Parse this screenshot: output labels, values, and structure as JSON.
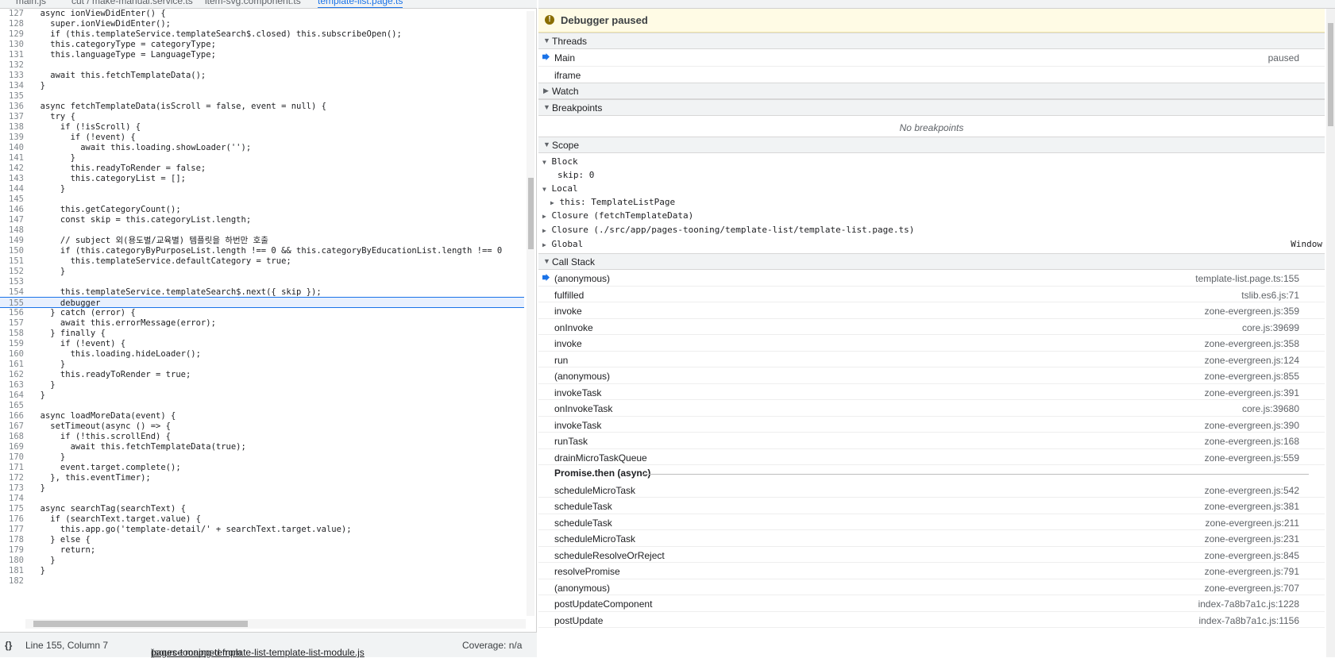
{
  "tabs": [
    "main.js",
    "cut / make-manual.service.ts",
    "item-svg.component.ts",
    "template-list.page.ts"
  ],
  "code_lines": [
    {
      "n": "127",
      "t": "  async ionViewDidEnter() {"
    },
    {
      "n": "128",
      "t": "    super.ionViewDidEnter();"
    },
    {
      "n": "129",
      "t": "    if (this.templateService.templateSearch$.closed) this.subscribeOpen();"
    },
    {
      "n": "130",
      "t": "    this.categoryType = categoryType;"
    },
    {
      "n": "131",
      "t": "    this.languageType = LanguageType;"
    },
    {
      "n": "132",
      "t": ""
    },
    {
      "n": "133",
      "t": "    await this.fetchTemplateData();"
    },
    {
      "n": "134",
      "t": "  }"
    },
    {
      "n": "135",
      "t": ""
    },
    {
      "n": "136",
      "t": "  async fetchTemplateData(isScroll = false, event = null) {"
    },
    {
      "n": "137",
      "t": "    try {"
    },
    {
      "n": "138",
      "t": "      if (!isScroll) {"
    },
    {
      "n": "139",
      "t": "        if (!event) {"
    },
    {
      "n": "140",
      "t": "          await this.loading.showLoader('');"
    },
    {
      "n": "141",
      "t": "        }"
    },
    {
      "n": "142",
      "t": "        this.readyToRender = false;"
    },
    {
      "n": "143",
      "t": "        this.categoryList = [];"
    },
    {
      "n": "144",
      "t": "      }"
    },
    {
      "n": "145",
      "t": ""
    },
    {
      "n": "146",
      "t": "      this.getCategoryCount();"
    },
    {
      "n": "147",
      "t": "      const skip = this.categoryList.length;"
    },
    {
      "n": "148",
      "t": ""
    },
    {
      "n": "149",
      "t": "      // subject 외(용도별/교육별) 템플릿을 하번만 호출"
    },
    {
      "n": "150",
      "t": "      if (this.categoryByPurposeList.length !== 0 && this.categoryByEducationList.length !== 0"
    },
    {
      "n": "151",
      "t": "        this.templateService.defaultCategory = true;"
    },
    {
      "n": "152",
      "t": "      }"
    },
    {
      "n": "153",
      "t": ""
    },
    {
      "n": "154",
      "t": "      this.templateService.templateSearch$.next({ skip });"
    },
    {
      "n": "155",
      "t": "      debugger"
    },
    {
      "n": "156",
      "t": "    } catch (error) {"
    },
    {
      "n": "157",
      "t": "      await this.errorMessage(error);"
    },
    {
      "n": "158",
      "t": "    } finally {"
    },
    {
      "n": "159",
      "t": "      if (!event) {"
    },
    {
      "n": "160",
      "t": "        this.loading.hideLoader();"
    },
    {
      "n": "161",
      "t": "      }"
    },
    {
      "n": "162",
      "t": "      this.readyToRender = true;"
    },
    {
      "n": "163",
      "t": "    }"
    },
    {
      "n": "164",
      "t": "  }"
    },
    {
      "n": "165",
      "t": ""
    },
    {
      "n": "166",
      "t": "  async loadMoreData(event) {"
    },
    {
      "n": "167",
      "t": "    setTimeout(async () => {"
    },
    {
      "n": "168",
      "t": "      if (!this.scrollEnd) {"
    },
    {
      "n": "169",
      "t": "        await this.fetchTemplateData(true);"
    },
    {
      "n": "170",
      "t": "      }"
    },
    {
      "n": "171",
      "t": "      event.target.complete();"
    },
    {
      "n": "172",
      "t": "    }, this.eventTimer);"
    },
    {
      "n": "173",
      "t": "  }"
    },
    {
      "n": "174",
      "t": ""
    },
    {
      "n": "175",
      "t": "  async searchTag(searchText) {"
    },
    {
      "n": "176",
      "t": "    if (searchText.target.value) {"
    },
    {
      "n": "177",
      "t": "      this.app.go('template-detail/' + searchText.target.value);"
    },
    {
      "n": "178",
      "t": "    } else {"
    },
    {
      "n": "179",
      "t": "      return;"
    },
    {
      "n": "180",
      "t": "    }"
    },
    {
      "n": "181",
      "t": "  }"
    },
    {
      "n": "182",
      "t": ""
    }
  ],
  "status": {
    "braces": "{}",
    "position": "Line 155, Column 7",
    "source_prefix": "(source mapped from ",
    "source_link": "pages-tooning-template-list-template-list-module.js",
    "source_suffix": ")",
    "coverage": "Coverage: n/a"
  },
  "debugger": {
    "paused_label": "Debugger paused",
    "threads_label": "Threads",
    "threads": [
      {
        "name": "Main",
        "state": "paused"
      },
      {
        "name": "iframe",
        "state": ""
      }
    ],
    "watch_label": "Watch",
    "breakpoints_label": "Breakpoints",
    "no_breakpoints": "No breakpoints",
    "scope_label": "Scope",
    "block_label": "Block",
    "skip_entry": "skip: 0",
    "local_label": "Local",
    "this_entry": "this: TemplateListPage",
    "closure1": "Closure (fetchTemplateData)",
    "closure2": "Closure (./src/app/pages-tooning/template-list/template-list.page.ts)",
    "global_label": "Global",
    "global_value": "Window",
    "callstack_label": "Call Stack",
    "frames": [
      {
        "name": "(anonymous)",
        "loc": "template-list.page.ts:155"
      },
      {
        "name": "fulfilled",
        "loc": "tslib.es6.js:71"
      },
      {
        "name": "invoke",
        "loc": "zone-evergreen.js:359"
      },
      {
        "name": "onInvoke",
        "loc": "core.js:39699"
      },
      {
        "name": "invoke",
        "loc": "zone-evergreen.js:358"
      },
      {
        "name": "run",
        "loc": "zone-evergreen.js:124"
      },
      {
        "name": "(anonymous)",
        "loc": "zone-evergreen.js:855"
      },
      {
        "name": "invokeTask",
        "loc": "zone-evergreen.js:391"
      },
      {
        "name": "onInvokeTask",
        "loc": "core.js:39680"
      },
      {
        "name": "invokeTask",
        "loc": "zone-evergreen.js:390"
      },
      {
        "name": "runTask",
        "loc": "zone-evergreen.js:168"
      },
      {
        "name": "drainMicroTaskQueue",
        "loc": "zone-evergreen.js:559"
      }
    ],
    "async_label": "Promise.then (async)",
    "frames_after": [
      {
        "name": "scheduleMicroTask",
        "loc": "zone-evergreen.js:542"
      },
      {
        "name": "scheduleTask",
        "loc": "zone-evergreen.js:381"
      },
      {
        "name": "scheduleTask",
        "loc": "zone-evergreen.js:211"
      },
      {
        "name": "scheduleMicroTask",
        "loc": "zone-evergreen.js:231"
      },
      {
        "name": "scheduleResolveOrReject",
        "loc": "zone-evergreen.js:845"
      },
      {
        "name": "resolvePromise",
        "loc": "zone-evergreen.js:791"
      },
      {
        "name": "(anonymous)",
        "loc": "zone-evergreen.js:707"
      },
      {
        "name": "postUpdateComponent",
        "loc": "index-7a8b7a1c.js:1228"
      },
      {
        "name": "postUpdate",
        "loc": "index-7a8b7a1c.js:1156"
      }
    ]
  },
  "colors": {
    "accent": "#1a73e8",
    "paused_bg": "#fffbe5",
    "exec_line": "#e8f0fe"
  }
}
